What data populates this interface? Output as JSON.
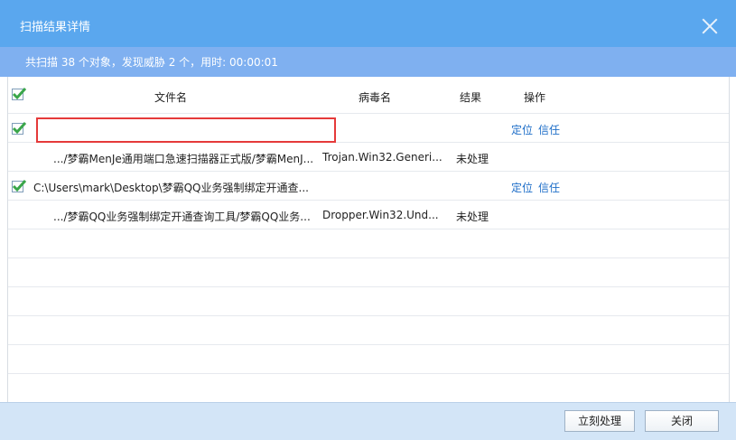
{
  "window": {
    "title": "扫描结果详情"
  },
  "summary": {
    "text": "共扫描 38 个对象，发现威胁 2 个，用时: 00:00:01"
  },
  "table": {
    "headers": {
      "file": "文件名",
      "virus": "病毒名",
      "result": "结果",
      "action": "操作"
    },
    "groups": [
      {
        "path": "",
        "actions": {
          "locate": "定位",
          "trust": "信任"
        },
        "detail": {
          "file": ".../梦霸MenJe通用端口急速扫描器正式版/梦霸MenJ...",
          "virus": "Trojan.Win32.Generi...",
          "result": "未处理"
        }
      },
      {
        "path": "C:\\Users\\mark\\Desktop\\梦霸QQ业务强制绑定开通查...",
        "actions": {
          "locate": "定位",
          "trust": "信任"
        },
        "detail": {
          "file": ".../梦霸QQ业务强制绑定开通查询工具/梦霸QQ业务...",
          "virus": "Dropper.Win32.Und...",
          "result": "未处理"
        }
      }
    ]
  },
  "footer": {
    "process_label": "立刻处理",
    "close_label": "关闭"
  },
  "colors": {
    "titlebar": "#5aa7ee",
    "summary_bar": "#7fb0f0",
    "link": "#1e6ec8",
    "check": "#3aa64a",
    "highlight_box": "#e53a3a"
  }
}
